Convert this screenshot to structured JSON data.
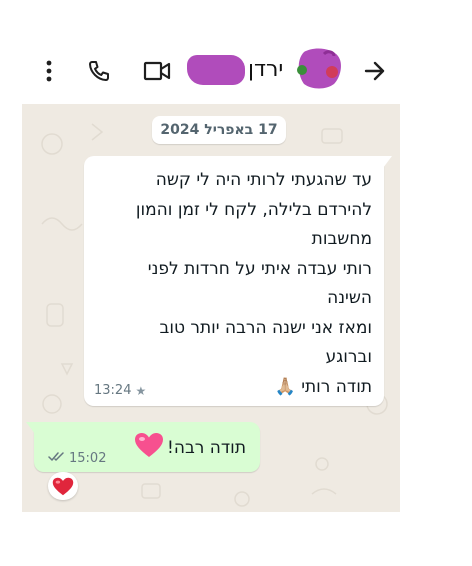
{
  "header": {
    "contact_name": "ירדן",
    "back_icon": "arrow-right-icon",
    "call_icon": "phone-icon",
    "video_icon": "video-camera-icon",
    "menu_icon": "kebab-menu-icon"
  },
  "chat": {
    "date_label": "17 באפריל 2024",
    "incoming": {
      "lines": [
        "עד שהגעתי לרותי היה לי קשה",
        "להירדם בלילה, לקח לי זמן והמון",
        "מחשבות",
        "רותי עבדה איתי על חרדות לפני",
        "השינה",
        "ומאז אני ישנה הרבה יותר טוב",
        "וברוגע",
        "תודה רותי 🙏🏼"
      ],
      "time": "13:24",
      "starred": true
    },
    "outgoing": {
      "text": "תודה רבה!",
      "emoji": "heart-emoji",
      "time": "15:02",
      "status": "double-check-read",
      "reaction": "red-heart-reaction"
    }
  },
  "colors": {
    "chat_bg": "#efeae2",
    "incoming_bg": "#ffffff",
    "outgoing_bg": "#d9fdd3",
    "meta_text": "#667781"
  }
}
